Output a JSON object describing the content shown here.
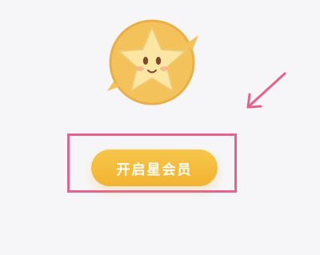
{
  "membership": {
    "open_button_label": "开启星会员"
  },
  "icons": {
    "mascot": "star-mascot-icon",
    "arrow": "pointer-arrow-icon"
  },
  "colors": {
    "button": "#f2b331",
    "highlight": "#e5628c",
    "background": "#f6f6f8"
  }
}
